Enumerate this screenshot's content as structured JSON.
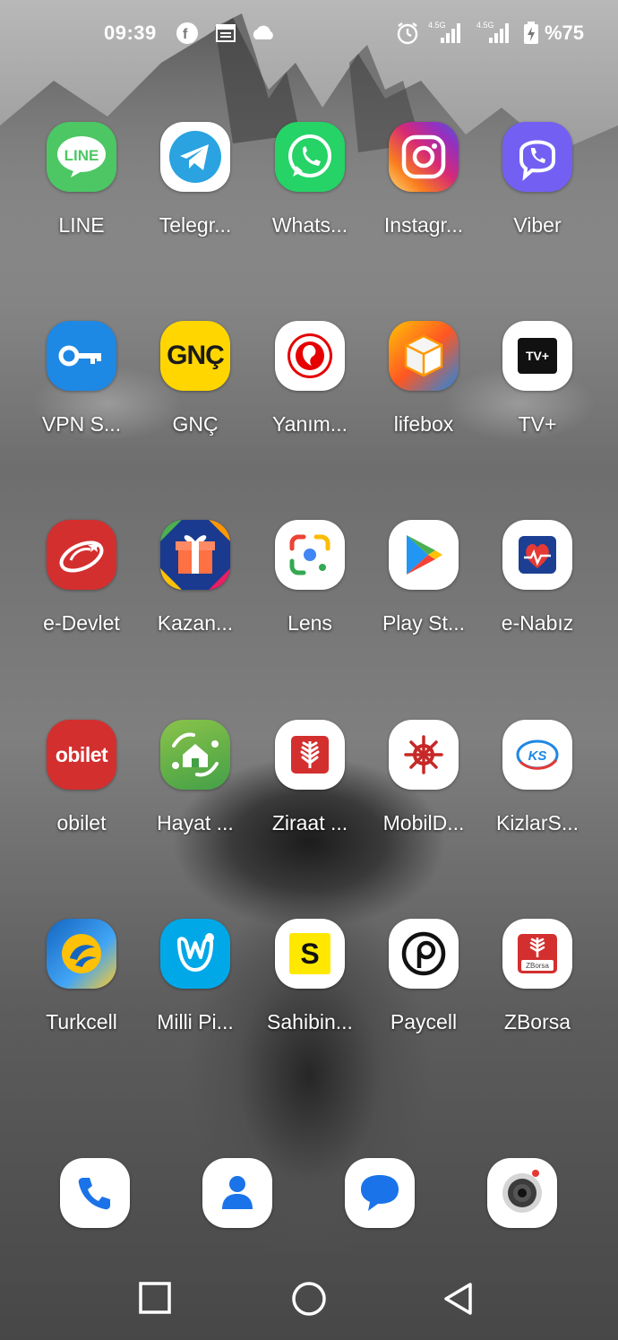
{
  "status_bar": {
    "time": "09:39",
    "network_1": "4.5G",
    "network_2": "4.5G",
    "battery": "%75"
  },
  "apps": [
    {
      "label": "LINE",
      "icon": "line-icon",
      "text": "LINE",
      "bg": "#4cc764"
    },
    {
      "label": "Telegr...",
      "icon": "telegram-icon",
      "bg": "#ffffff"
    },
    {
      "label": "Whats...",
      "icon": "whatsapp-icon",
      "bg": "#25d366"
    },
    {
      "label": "Instagr...",
      "icon": "instagram-icon",
      "bg": "#e1306c"
    },
    {
      "label": "Viber",
      "icon": "viber-icon",
      "bg": "#7360f2"
    },
    {
      "label": "VPN S...",
      "icon": "vpn-key-icon",
      "bg": "#1e88e5"
    },
    {
      "label": "GNÇ",
      "icon": "gnc-icon",
      "text": "GNÇ",
      "bg": "#ffd600"
    },
    {
      "label": "Yanım...",
      "icon": "vodafone-icon",
      "bg": "#ffffff"
    },
    {
      "label": "lifebox",
      "icon": "lifebox-cube-icon",
      "bg": "#1e88e5"
    },
    {
      "label": "TV+",
      "icon": "tvplus-icon",
      "text": "TV+",
      "bg": "#ffffff"
    },
    {
      "label": "e-Devlet",
      "icon": "edevlet-icon",
      "bg": "#d32f2f"
    },
    {
      "label": "Kazan...",
      "icon": "gift-icon",
      "bg": "#1a3a8f"
    },
    {
      "label": "Lens",
      "icon": "google-lens-icon",
      "bg": "#ffffff"
    },
    {
      "label": "Play St...",
      "icon": "google-play-icon",
      "bg": "#ffffff"
    },
    {
      "label": "e-Nabız",
      "icon": "enabiz-icon",
      "bg": "#ffffff"
    },
    {
      "label": "obilet",
      "icon": "obilet-icon",
      "text": "obilet",
      "bg": "#d32f2f"
    },
    {
      "label": "Hayat ...",
      "icon": "hayat-eve-sigar-icon",
      "bg": "#4caf50"
    },
    {
      "label": "Ziraat ...",
      "icon": "ziraat-icon",
      "bg": "#ffffff"
    },
    {
      "label": "MobilD...",
      "icon": "ship-wheel-icon",
      "bg": "#ffffff"
    },
    {
      "label": "KizlarS...",
      "icon": "ks-logo-icon",
      "text": "KS",
      "bg": "#ffffff"
    },
    {
      "label": "Turkcell",
      "icon": "turkcell-icon",
      "bg": "#1e88e5"
    },
    {
      "label": "Milli Pi...",
      "icon": "milli-piyango-icon",
      "bg": "#00a8e8"
    },
    {
      "label": "Sahibin...",
      "icon": "sahibinden-icon",
      "text": "S",
      "bg": "#ffffff"
    },
    {
      "label": "Paycell",
      "icon": "paycell-icon",
      "bg": "#ffffff"
    },
    {
      "label": "ZBorsa",
      "icon": "zborsa-icon",
      "text": "ZBorsa",
      "bg": "#ffffff"
    }
  ],
  "dock": [
    {
      "name": "phone-icon"
    },
    {
      "name": "contacts-icon"
    },
    {
      "name": "messages-icon"
    },
    {
      "name": "camera-icon"
    }
  ],
  "nav": [
    "recents-button",
    "home-button",
    "back-button"
  ]
}
